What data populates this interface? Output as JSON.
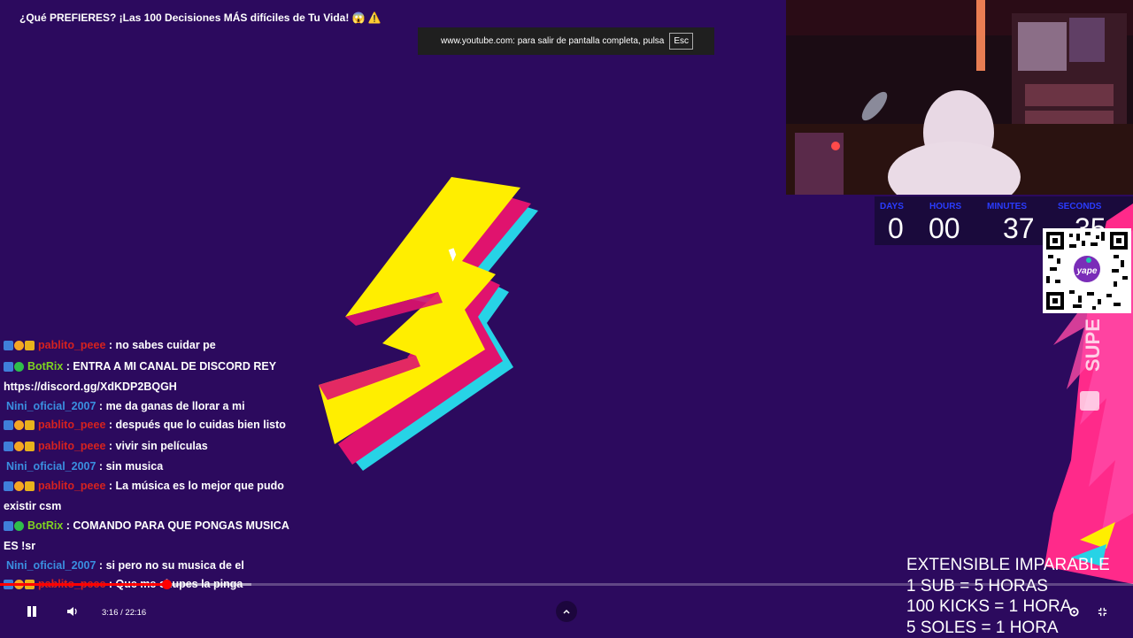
{
  "video": {
    "title": "¿Qué PREFIERES? ¡Las 100 Decisiones MÁS difíciles de Tu Vida! 😱 ⚠️"
  },
  "fullscreen_toast": {
    "text": "www.youtube.com: para salir de pantalla completa, pulsa",
    "key": "Esc"
  },
  "timer": {
    "labels": [
      "DAYS",
      "HOURS",
      "MINUTES",
      "SECONDS"
    ],
    "days": "0",
    "hours": "00",
    "minutes": "37",
    "seconds": "35"
  },
  "qr": {
    "brand": "yape"
  },
  "side_banner": {
    "text": "SUPE"
  },
  "chat": {
    "messages": [
      {
        "user": "pablito_peee",
        "color": "red",
        "badges": [
          "blue",
          "orange",
          "gold"
        ],
        "text": "no sabes cuidar pe"
      },
      {
        "user": "BotRix",
        "color": "green",
        "badges": [
          "blue",
          "green"
        ],
        "text": "ENTRA A MI CANAL DE DISCORD REY https://discord.gg/XdKDP2BQGH"
      },
      {
        "user": "Nini_oficial_2007",
        "color": "blue",
        "badges": [],
        "text": "me da ganas de llorar a mi"
      },
      {
        "user": "pablito_peee",
        "color": "red",
        "badges": [
          "blue",
          "orange",
          "gold"
        ],
        "text": "después que lo cuidas bien listo"
      },
      {
        "user": "pablito_peee",
        "color": "red",
        "badges": [
          "blue",
          "orange",
          "gold"
        ],
        "text": "vivir sin películas"
      },
      {
        "user": "Nini_oficial_2007",
        "color": "blue",
        "badges": [],
        "text": "sin musica"
      },
      {
        "user": "pablito_peee",
        "color": "red",
        "badges": [
          "blue",
          "orange",
          "gold"
        ],
        "text": "La música es lo mejor que pudo existir csm"
      },
      {
        "user": "BotRix",
        "color": "green",
        "badges": [
          "blue",
          "green"
        ],
        "text": "COMANDO PARA QUE PONGAS MUSICA ES !sr"
      },
      {
        "user": "Nini_oficial_2007",
        "color": "blue",
        "badges": [],
        "text": "si pero no su musica de el"
      },
      {
        "user": "pablito_peee",
        "color": "red",
        "badges": [
          "blue",
          "orange",
          "gold"
        ],
        "text": "Que me chupes la pinga"
      }
    ]
  },
  "overlay": {
    "lines": [
      "EXTENSIBLE IMPARABLE",
      "1 SUB = 5 HORAS",
      "100 KICKS  = 1 HORA",
      "5 SOLES = 1 HORA"
    ]
  },
  "player": {
    "current_time": "3:16",
    "duration": "22:16",
    "progress_fraction": 0.1467,
    "buffer_fraction": 0.222,
    "icons": {
      "play_pause": "pause-icon",
      "volume": "volume-icon",
      "chevron": "chevron-up-icon",
      "settings": "gear-icon",
      "exit_fullscreen": "exit-fullscreen-icon"
    }
  },
  "colors": {
    "background": "#2c0a5e",
    "bolt_yellow": "#ffee00",
    "bolt_pink": "#e0136e",
    "bolt_cyan": "#27d3e6",
    "progress_red": "#ff0000"
  }
}
